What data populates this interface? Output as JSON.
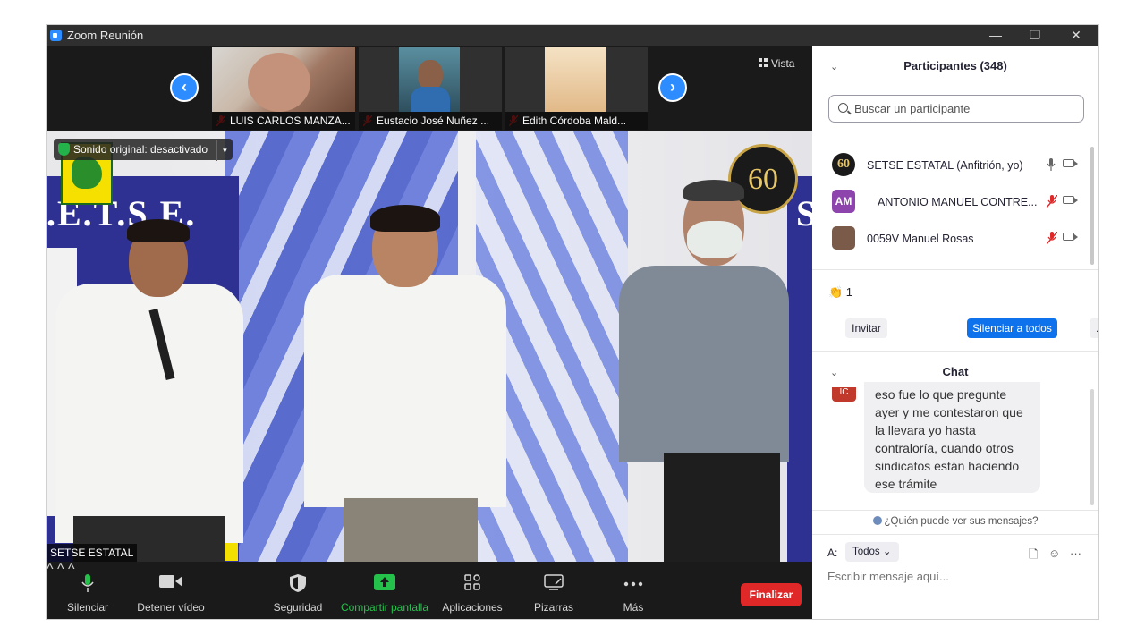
{
  "window": {
    "title": "Zoom Reunión",
    "controls": {
      "minimize": "—",
      "restore": "❐",
      "close": "✕"
    }
  },
  "strip": {
    "prev": "‹",
    "next": "›",
    "vista": "Vista",
    "thumbnails": [
      {
        "name": "LUIS CARLOS MANZA..."
      },
      {
        "name": "Eustacio José Nuñez ..."
      },
      {
        "name": "Edith Córdoba Mald..."
      }
    ]
  },
  "main_video": {
    "original_sound": "Sonido original: desactivado",
    "caret": "▾",
    "speaker": "SETSE ESTATAL",
    "banner_text": ".E.T.S.E.",
    "banner_right": "S",
    "seal_number": "60"
  },
  "toolbar": {
    "mute": "Silenciar",
    "stop_video": "Detener vídeo",
    "security": "Seguridad",
    "share": "Compartir pantalla",
    "apps": "Aplicaciones",
    "whiteboards": "Pizarras",
    "more": "Más",
    "end": "Finalizar",
    "caret": "^",
    "colors": {
      "share": "#24c24b",
      "end": "#e02828"
    }
  },
  "participants": {
    "title": "Participantes (348)",
    "search_placeholder": "Buscar un participante",
    "list": [
      {
        "avatar": "60",
        "name": "SETSE ESTATAL (Anfitrión, yo)"
      },
      {
        "avatar": "AM",
        "name": "ANTONIO MANUEL CONTRE..."
      },
      {
        "avatar": "",
        "name": "0059V Manuel Rosas"
      }
    ],
    "reaction": "👏 1",
    "invite": "Invitar",
    "mute_all": "Silenciar a todos",
    "more": "...",
    "accent": "#0e72ed"
  },
  "chat": {
    "title": "Chat",
    "avatar": "IC",
    "message_lines": [
      "eso fue lo que pregunte",
      "ayer y me contestaron que",
      "la llevara yo hasta",
      "contraloría, cuando otros",
      "sindicatos están haciendo",
      "ese trámite"
    ],
    "who_sees": "¿Quién puede ver sus mensajes?",
    "to_label": "A:",
    "to_value": "Todos",
    "input_placeholder": "Escribir mensaje aquí..."
  }
}
